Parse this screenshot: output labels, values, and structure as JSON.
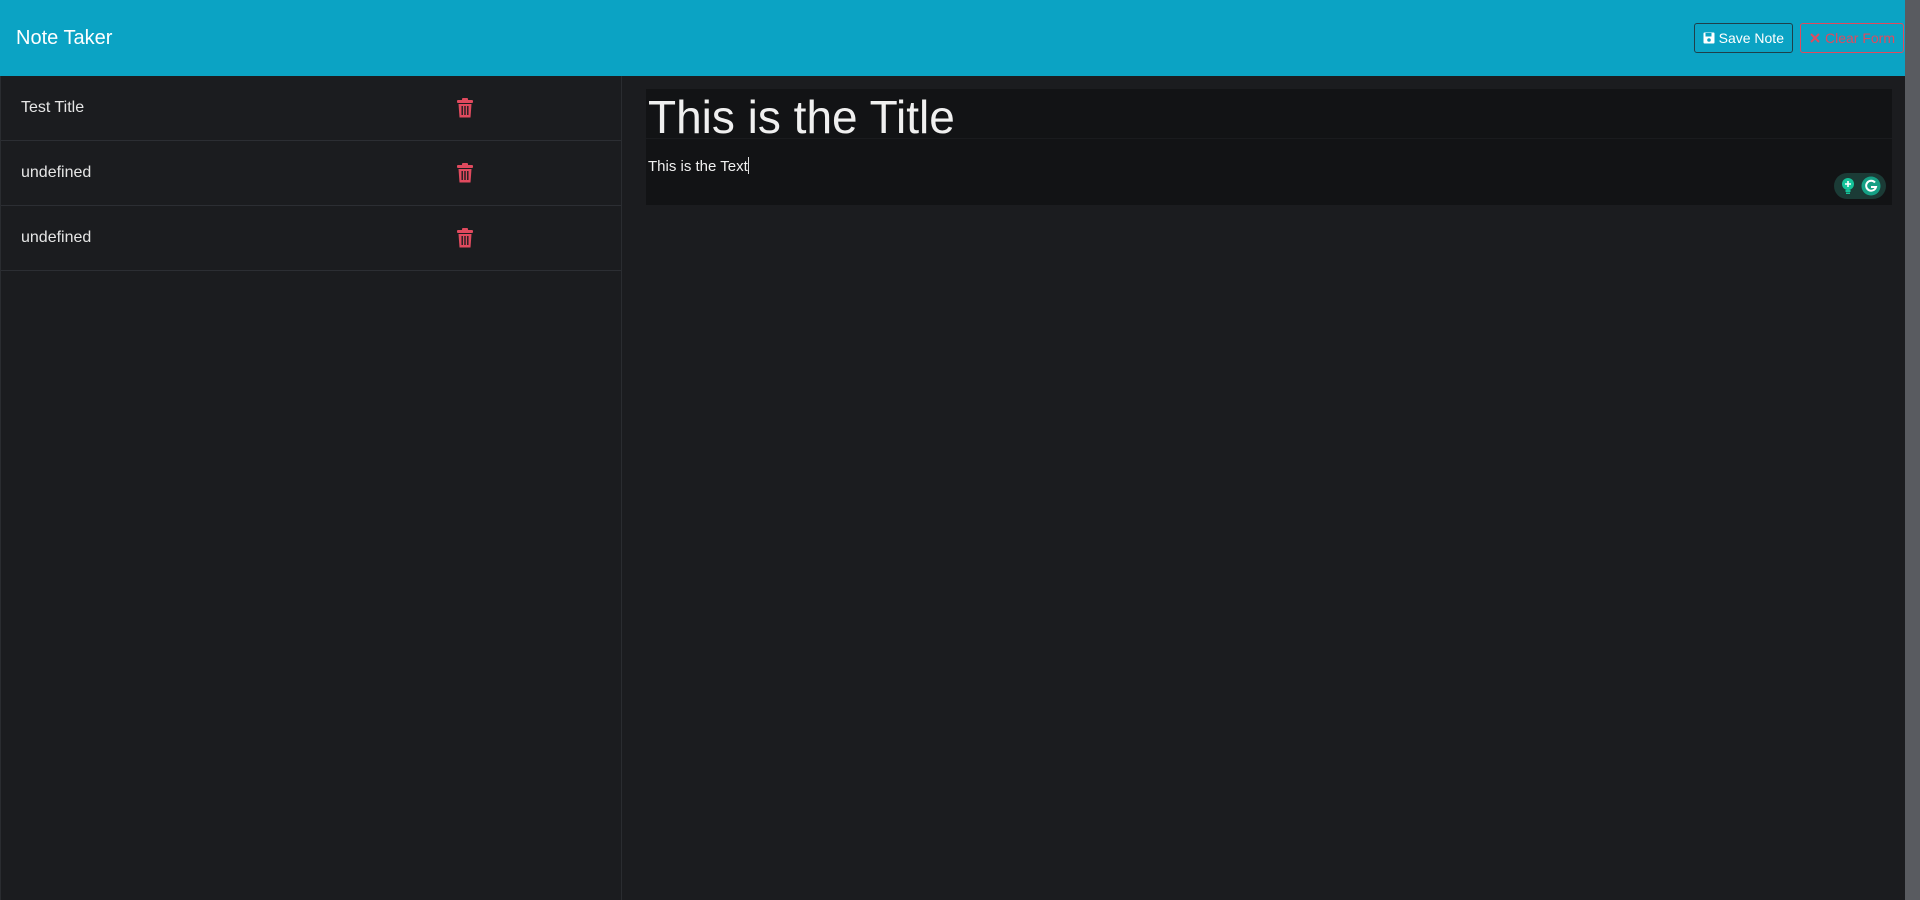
{
  "navbar": {
    "brand": "Note Taker",
    "save_label": "Save Note",
    "clear_label": "Clear Form"
  },
  "notes": [
    {
      "title": "Test Title"
    },
    {
      "title": "undefined"
    },
    {
      "title": "undefined"
    }
  ],
  "editor": {
    "title_value": "This is the Title",
    "text_value": "This is the Text"
  },
  "colors": {
    "navbar": "#0ba3c4",
    "background": "#1b1c1f",
    "danger": "#e04a5e",
    "editor": "#121315"
  },
  "icons": {
    "save": "floppy-disk-icon",
    "clear": "x-icon",
    "delete": "trash-icon",
    "grammarly": "grammarly-icon",
    "suggestion": "lightbulb-icon"
  }
}
